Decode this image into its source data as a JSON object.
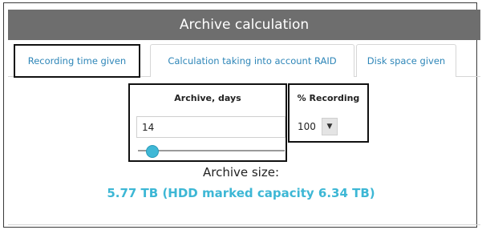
{
  "header": {
    "title": "Archive calculation"
  },
  "tabs": [
    {
      "label": "Recording time given",
      "active": true
    },
    {
      "label": "Calculation taking into account RAID",
      "active": false
    },
    {
      "label": "Disk space given",
      "active": false
    }
  ],
  "archive": {
    "label": "Archive, days",
    "value": "14",
    "slider_fraction": 0.1
  },
  "recording": {
    "label": "% Recording",
    "selected": "100",
    "caret_icon": "caret-down-icon"
  },
  "result": {
    "label": "Archive size:",
    "value": "5.77 TB (HDD marked capacity 6.34 TB)"
  },
  "colors": {
    "header_bg": "#6e6e6e",
    "tab_text": "#2e86b8",
    "accent": "#3db7d5",
    "slider_handle": "#3fb8d6"
  }
}
